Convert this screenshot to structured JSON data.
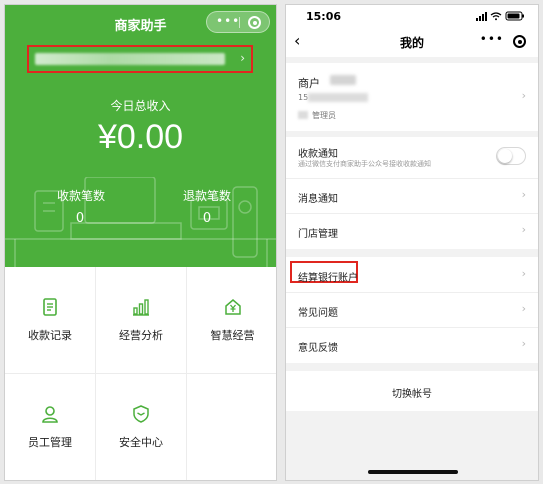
{
  "left": {
    "title": "商家助手",
    "merchant_chevron": "›",
    "income_label": "今日总收入",
    "income_amount": "¥0.00",
    "stats": [
      {
        "label": "收款笔数",
        "value": "0"
      },
      {
        "label": "退款笔数",
        "value": "0"
      }
    ],
    "menu": [
      {
        "label": "收款记录",
        "icon": "receipt-icon"
      },
      {
        "label": "经营分析",
        "icon": "bar-chart-icon"
      },
      {
        "label": "智慧经营",
        "icon": "yuan-house-icon"
      },
      {
        "label": "员工管理",
        "icon": "person-icon"
      },
      {
        "label": "安全中心",
        "icon": "shield-icon"
      }
    ],
    "accent": "#4caf3c"
  },
  "right": {
    "time": "15:06",
    "nav_title": "我的",
    "nav_back": "‹",
    "account": {
      "name_prefix": "商户",
      "line2_prefix": "15",
      "role": "管理员"
    },
    "notice": {
      "title": "收款通知",
      "desc": "通过微信支付商家助手公众号接收收款通知",
      "enabled": false
    },
    "rows_a": [
      "消息通知",
      "门店管理"
    ],
    "rows_b": [
      "结算银行账户",
      "常见问题",
      "意见反馈"
    ],
    "chevron": "›",
    "switch_account": "切换帐号",
    "highlight_color": "#e0261f"
  }
}
